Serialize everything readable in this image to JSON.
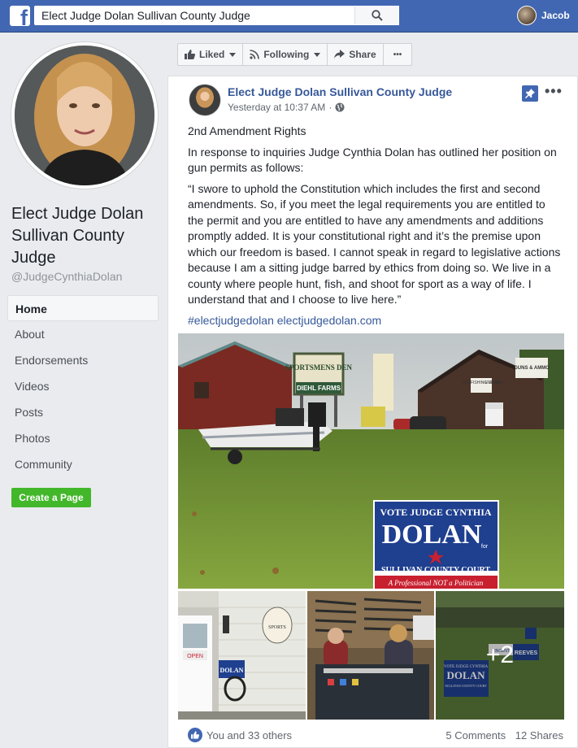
{
  "topbar": {
    "logo_letter": "f",
    "search_value": "Elect Judge Dolan Sullivan County Judge",
    "user_name": "Jacob"
  },
  "page": {
    "name": "Elect Judge Dolan Sullivan County Judge",
    "handle": "@JudgeCynthiaDolan",
    "nav": [
      {
        "label": "Home",
        "active": true
      },
      {
        "label": "About"
      },
      {
        "label": "Endorsements"
      },
      {
        "label": "Videos"
      },
      {
        "label": "Posts"
      },
      {
        "label": "Photos"
      },
      {
        "label": "Community"
      }
    ],
    "create_page_label": "Create a Page"
  },
  "actions": {
    "liked": "Liked",
    "following": "Following",
    "share": "Share",
    "more": "•••"
  },
  "post": {
    "author": "Elect Judge Dolan Sullivan County Judge",
    "time": "Yesterday at 10:37 AM",
    "separator": "·",
    "title": "2nd Amendment Rights",
    "intro": "In response to inquiries Judge Cynthia Dolan has outlined her position on gun permits as follows:",
    "quote": "“I swore to uphold the Constitution which includes the first and second amendments. So, if you meet the legal requirements you are entitled to the permit and you are entitled to have any amendments and additions promptly added. It is your constitutional right and it’s the premise upon which our freedom is based. I cannot speak in regard to legislative actions because I am a sitting judge barred by ethics from doing so. We live in a county where people hunt, fish, and shoot for sport as a way of life. I understand that and I choose to live here.”",
    "hashtag": "#electjudgedolan",
    "link": "electjudgedolan.com",
    "more_photos": "+2",
    "reactions": "You and 33 others",
    "comments": "5 Comments",
    "shares": "12 Shares"
  },
  "images": {
    "main_sign": {
      "line1": "VOTE JUDGE CYNTHIA",
      "line2": "DOLAN",
      "line3": "for",
      "line4": "SULLIVAN COUNTY COURT",
      "line5": "A Professional NOT a Politician"
    },
    "store_sign": "SPORTSMENS DEN",
    "store_sub": "DIEHL FARMS",
    "barn_signs": [
      "ICE FISHING GEAR",
      "GUNS & AMMO",
      "LIVE BAIT"
    ],
    "small1_sign": "DOLAN",
    "small1_open": "OPEN",
    "small1_plaque": "SPORTS",
    "small3_sign": "DOLAN",
    "small3_sign_top": "VOTE JUDGE CYNTHIA",
    "small3_sign_bottom": "SULLIVAN COUNTY COURT",
    "small3_other": [
      "REEVES",
      "VINCENT"
    ]
  },
  "colors": {
    "brand_blue": "#4267b2",
    "link_blue": "#365899",
    "create_green": "#42b72a",
    "sign_blue": "#1f3f8f",
    "sign_red": "#c8202f"
  }
}
